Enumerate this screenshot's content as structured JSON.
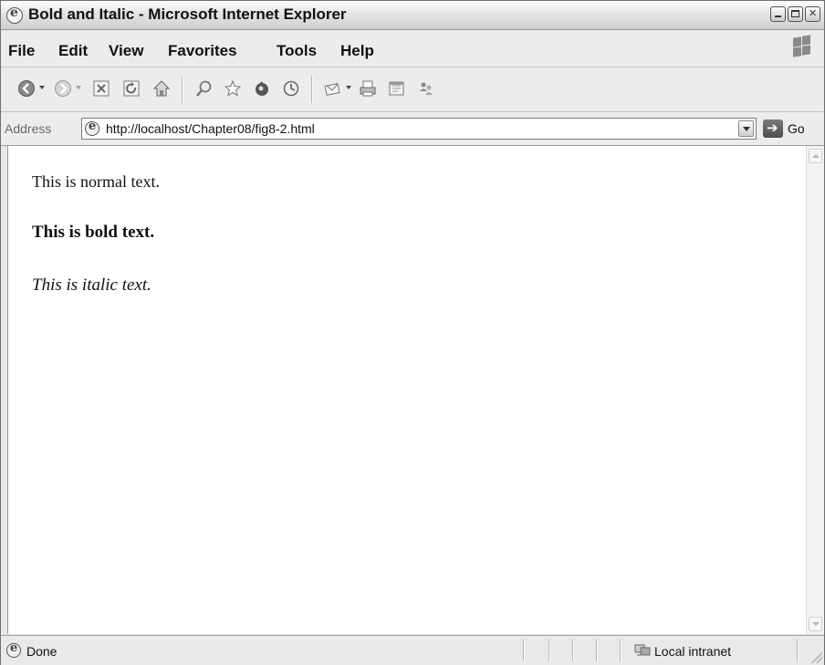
{
  "window": {
    "title": "Bold and Italic - Microsoft Internet Explorer"
  },
  "menu": {
    "items": [
      "File",
      "Edit",
      "View",
      "Favorites",
      "Tools",
      "Help"
    ]
  },
  "toolbar": {
    "icons": [
      "back-icon",
      "forward-icon",
      "stop-icon",
      "refresh-icon",
      "home-icon",
      "search-icon",
      "favorites-icon",
      "media-icon",
      "history-icon",
      "mail-icon",
      "print-icon",
      "edit-icon",
      "messenger-icon"
    ]
  },
  "address": {
    "label": "Address",
    "url": "http://localhost/Chapter08/fig8-2.html",
    "go_label": "Go"
  },
  "page": {
    "normal_text": "This is normal text.",
    "bold_text": "This is bold text.",
    "italic_text": "This is italic text."
  },
  "status": {
    "text": "Done",
    "zone": "Local intranet"
  }
}
